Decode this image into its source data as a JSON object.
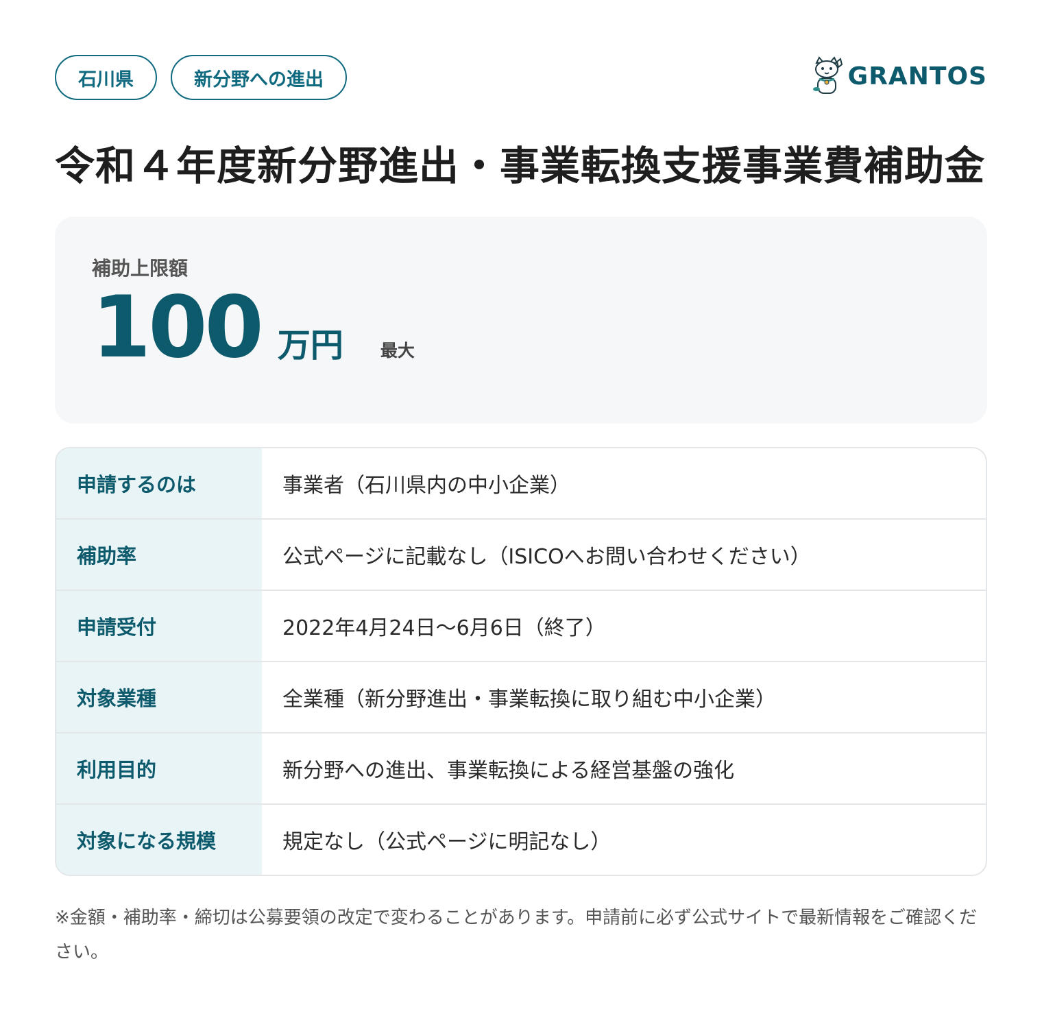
{
  "tags": [
    "石川県",
    "新分野への進出"
  ],
  "logo": {
    "text": "GRANTOS",
    "icon": "lucky-cat-icon"
  },
  "title": "令和４年度新分野進出・事業転換支援事業費補助金",
  "amount": {
    "label": "補助上限額",
    "value": "100",
    "unit": "万円",
    "note": "最大"
  },
  "info": [
    {
      "key": "申請するのは",
      "value": "事業者（石川県内の中小企業）"
    },
    {
      "key": "補助率",
      "value": "公式ページに記載なし（ISICOへお問い合わせください）"
    },
    {
      "key": "申請受付",
      "value": "2022年4月24日〜6月6日（終了）"
    },
    {
      "key": "対象業種",
      "value": "全業種（新分野進出・事業転換に取り組む中小企業）"
    },
    {
      "key": "利用目的",
      "value": "新分野への進出、事業転換による経営基盤の強化"
    },
    {
      "key": "対象になる規模",
      "value": "規定なし（公式ページに明記なし）"
    }
  ],
  "footnote": "※金額・補助率・締切は公募要領の改定で変わることがあります。申請前に必ず公式サイトで最新情報をご確認ください。",
  "colors": {
    "accent": "#0e5a6d",
    "tag_border": "#0f6a80",
    "key_background": "#e8f4f6",
    "card_background": "#f5f7f8"
  }
}
